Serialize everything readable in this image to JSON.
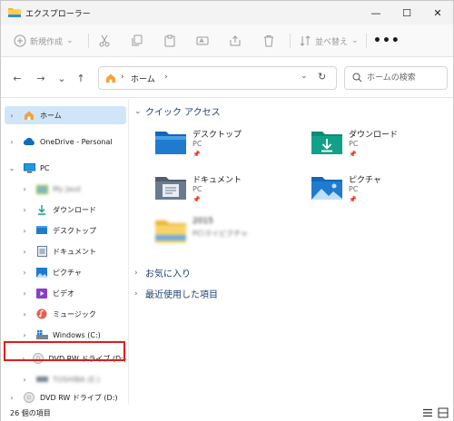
{
  "window": {
    "title": "エクスプローラー",
    "controls": {
      "minimize": "—",
      "maximize": "☐",
      "close": "✕"
    }
  },
  "toolbar": {
    "new_label": "新規作成",
    "sort_label": "並べ替え",
    "more_label": "•••"
  },
  "address": {
    "crumb": "ホーム",
    "separator": "›",
    "search_placeholder": "ホームの検索"
  },
  "sidebar": {
    "items": [
      {
        "label": "ホーム",
        "chevron": "›",
        "icon": "home-icon"
      },
      {
        "label": "OneDrive - Personal",
        "chevron": "›",
        "icon": "cloud-icon"
      },
      {
        "label": "PC",
        "chevron": "⌄",
        "icon": "pc-icon"
      },
      {
        "label": "My Jasd",
        "chevron": "›",
        "icon": "user-folder-icon",
        "blurred": true
      },
      {
        "label": "ダウンロード",
        "chevron": "›",
        "icon": "download-icon"
      },
      {
        "label": "デスクトップ",
        "chevron": "›",
        "icon": "desktop-icon"
      },
      {
        "label": "ドキュメント",
        "chevron": "›",
        "icon": "document-icon"
      },
      {
        "label": "ピクチャ",
        "chevron": "›",
        "icon": "picture-icon"
      },
      {
        "label": "ビデオ",
        "chevron": "›",
        "icon": "video-icon"
      },
      {
        "label": "ミュージック",
        "chevron": "›",
        "icon": "music-icon"
      },
      {
        "label": "Windows (C:)",
        "chevron": "›",
        "icon": "windows-drive-icon"
      },
      {
        "label": "DVD RW ドライブ (D:)",
        "chevron": "›",
        "icon": "dvd-icon"
      },
      {
        "label": "TOSHIBA (E:)",
        "chevron": "›",
        "icon": "usb-drive-icon",
        "blurred": true
      },
      {
        "label": "DVD RW ドライブ (D:)",
        "chevron": "›",
        "icon": "dvd-icon"
      }
    ]
  },
  "main": {
    "quick_access": {
      "chevron": "⌄",
      "title": "クイック アクセス",
      "tiles": [
        {
          "name": "デスクトップ",
          "sub": "PC",
          "pin": "📌",
          "icon": "desktop-folder-icon"
        },
        {
          "name": "ダウンロード",
          "sub": "PC",
          "pin": "📌",
          "icon": "download-folder-icon"
        },
        {
          "name": "ドキュメント",
          "sub": "PC",
          "pin": "📌",
          "icon": "document-folder-icon"
        },
        {
          "name": "ピクチャ",
          "sub": "PC",
          "pin": "📌",
          "icon": "picture-folder-icon"
        },
        {
          "name": "2015",
          "sub": "PC\\マイピクチャ",
          "pin": "",
          "icon": "folder-icon",
          "blurred": true
        }
      ]
    },
    "favorites": {
      "chevron": "›",
      "title": "お気に入り"
    },
    "recent": {
      "chevron": "›",
      "title": "最近使用した項目"
    }
  },
  "status": {
    "count": "26 個の項目"
  },
  "colors": {
    "accent": "#0067c0",
    "selection": "#d0e6f8",
    "highlight_box": "#e21b1b",
    "folder_blue": "#1f7bd0",
    "folder_teal": "#13a089"
  }
}
